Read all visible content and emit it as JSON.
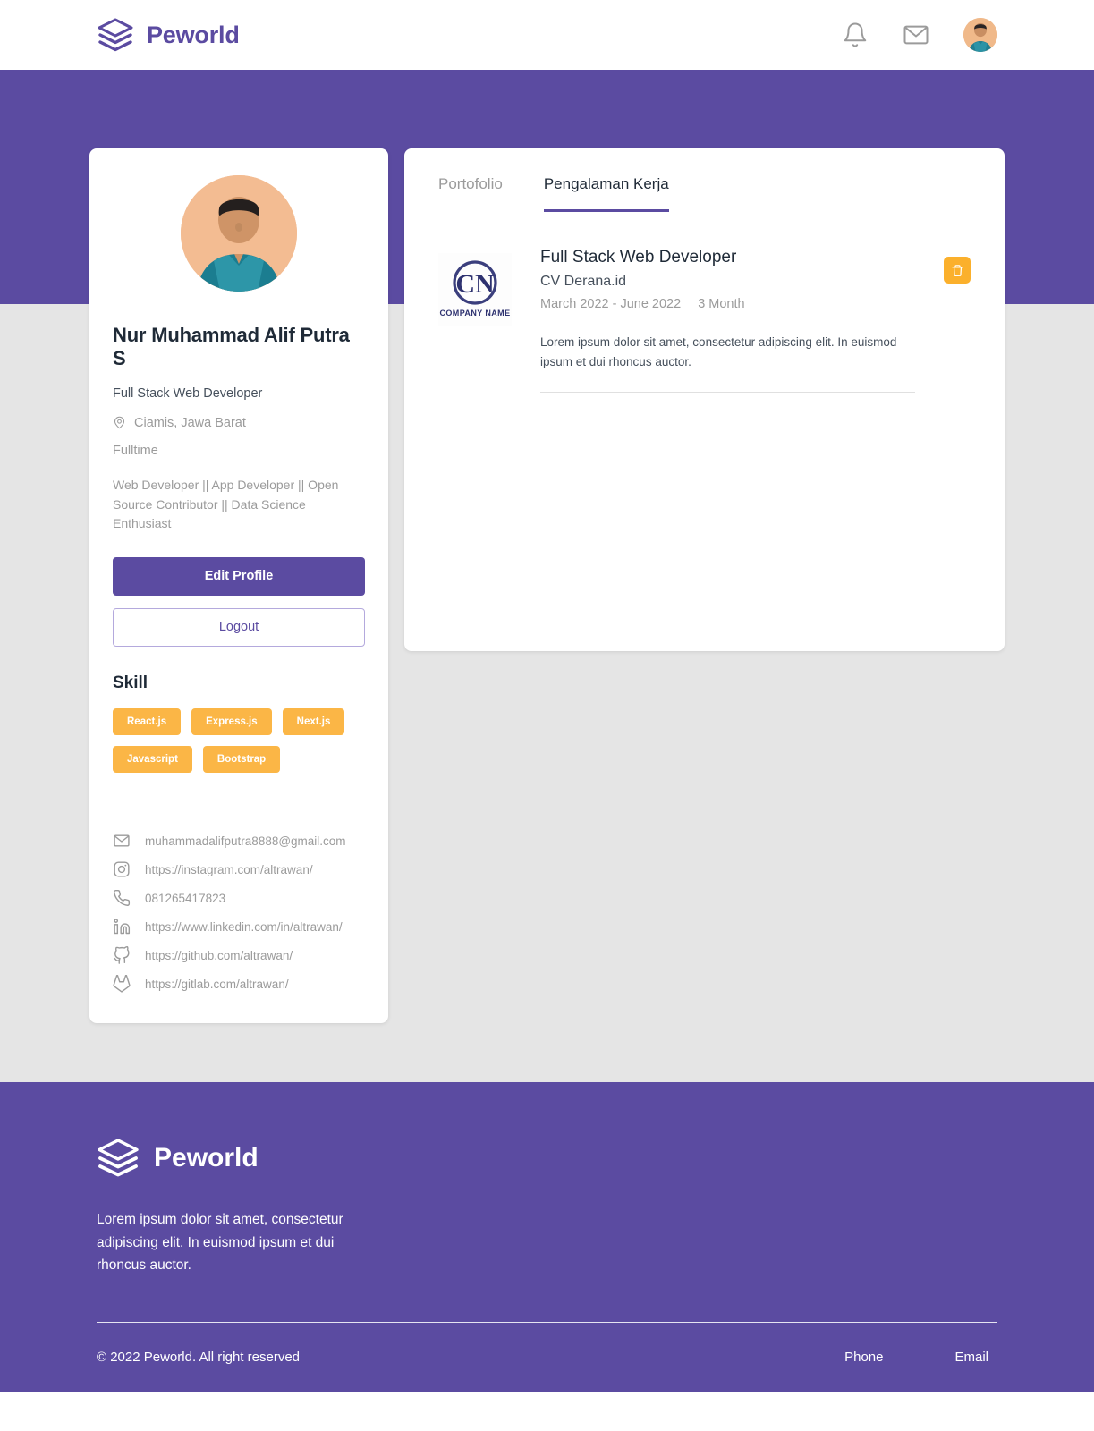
{
  "header": {
    "brand": "Peworld",
    "icons": [
      "bell-icon",
      "mail-icon",
      "avatar"
    ]
  },
  "profile": {
    "name": "Nur Muhammad Alif Putra S",
    "role": "Full Stack Web Developer",
    "location": "Ciamis, Jawa Barat",
    "work_type": "Fulltime",
    "description": "Web Developer || App Developer || Open Source Contributor || Data Science Enthusiast",
    "edit_button": "Edit Profile",
    "logout_button": "Logout",
    "skill_heading": "Skill",
    "skills": [
      "React.js",
      "Express.js",
      "Next.js",
      "Javascript",
      "Bootstrap"
    ],
    "contacts": [
      {
        "icon": "mail-icon",
        "value": "muhammadalifputra8888@gmail.com"
      },
      {
        "icon": "instagram-icon",
        "value": "https://instagram.com/altrawan/"
      },
      {
        "icon": "phone-icon",
        "value": "081265417823"
      },
      {
        "icon": "linkedin-icon",
        "value": "https://www.linkedin.com/in/altrawan/"
      },
      {
        "icon": "github-icon",
        "value": "https://github.com/altrawan/"
      },
      {
        "icon": "gitlab-icon",
        "value": "https://gitlab.com/altrawan/"
      }
    ]
  },
  "main": {
    "tabs": [
      {
        "label": "Portofolio",
        "active": false
      },
      {
        "label": "Pengalaman Kerja",
        "active": true
      }
    ],
    "experiences": [
      {
        "logo_initials": "CN",
        "logo_caption": "COMPANY NAME",
        "title": "Full Stack Web Developer",
        "company": "CV Derana.id",
        "period": "March 2022 - June 2022",
        "duration": "3  Month",
        "description": "Lorem ipsum dolor sit amet, consectetur adipiscing elit. In euismod ipsum et dui rhoncus auctor.",
        "delete_icon": "trash-icon"
      }
    ]
  },
  "footer": {
    "brand": "Peworld",
    "description": "Lorem ipsum dolor sit amet, consectetur adipiscing elit. In euismod ipsum et dui rhoncus auctor.",
    "copyright": "© 2022 Peworld. All right reserved",
    "links": [
      "Phone",
      "Email"
    ]
  },
  "colors": {
    "purple": "#5b4ba1",
    "yellow": "#fbb646",
    "orange": "#fbb02c",
    "page_bg": "#e5e5e5"
  }
}
